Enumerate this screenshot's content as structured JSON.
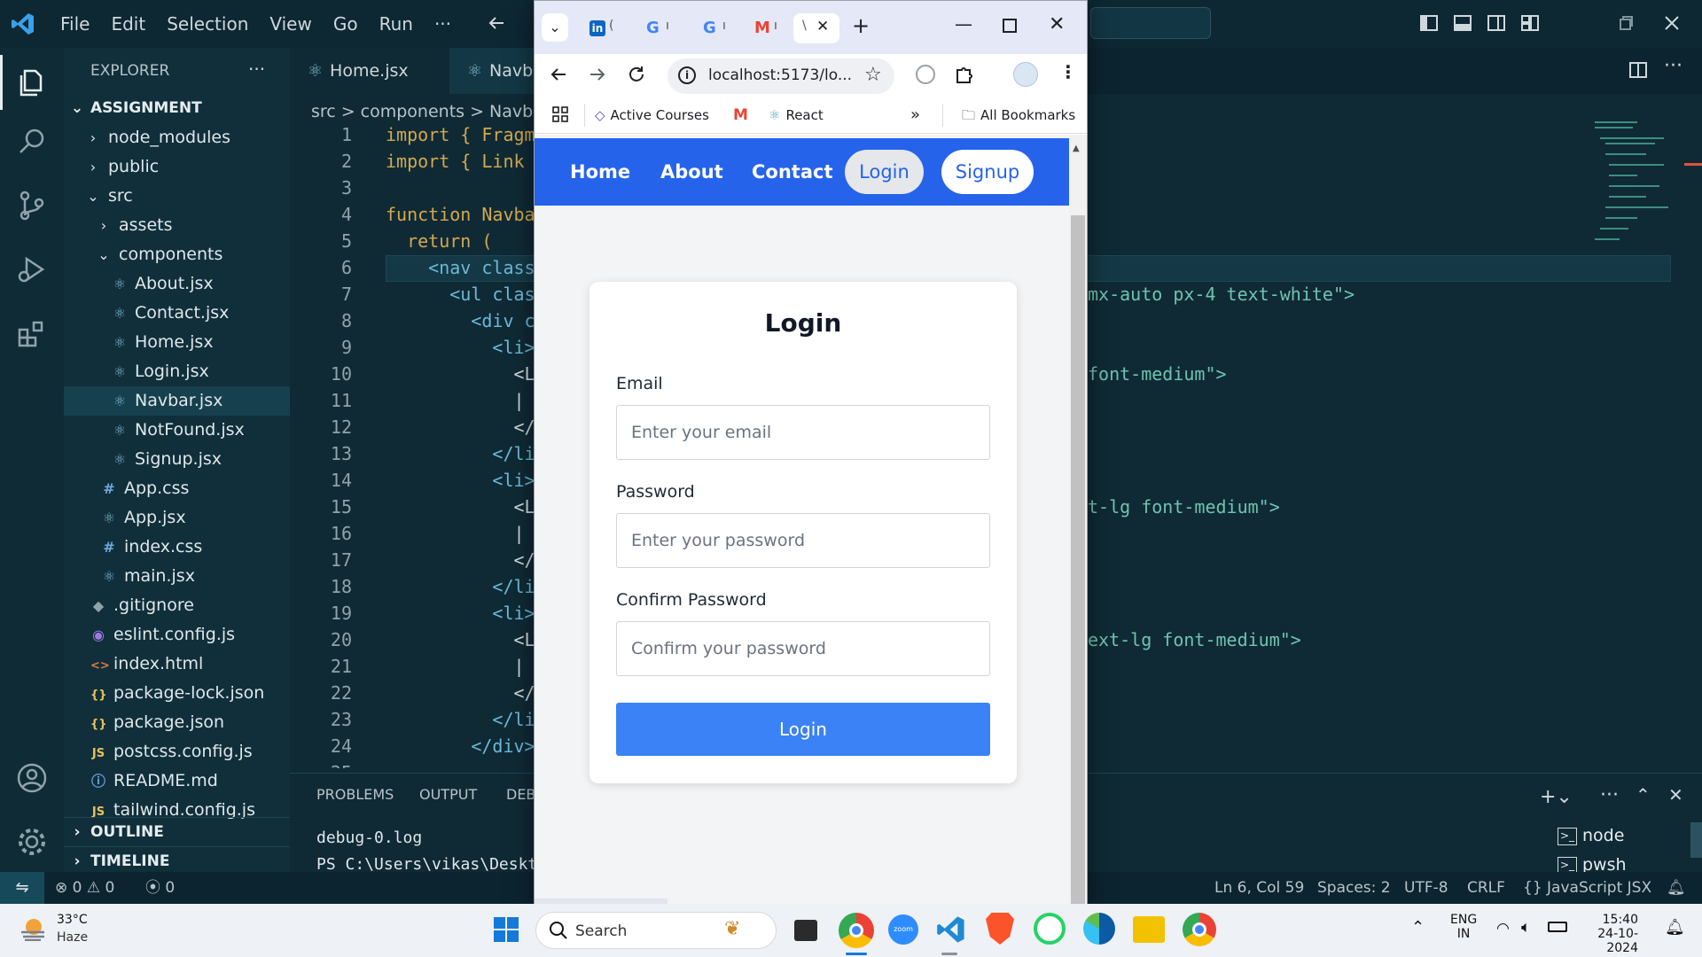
{
  "vscode": {
    "menus": [
      "File",
      "Edit",
      "Selection",
      "View",
      "Go",
      "Run",
      "···"
    ],
    "explorer": {
      "title": "EXPLORER",
      "more": "···",
      "root": "ASSIGNMENT",
      "items": [
        {
          "label": "node_modules",
          "icon": "›",
          "type": "folder"
        },
        {
          "label": "public",
          "icon": "›",
          "type": "folder"
        },
        {
          "label": "src",
          "icon": "⌄",
          "type": "folder"
        },
        {
          "label": "assets",
          "icon": "›",
          "type": "folder"
        },
        {
          "label": "components",
          "icon": "⌄",
          "type": "folder"
        },
        {
          "label": "About.jsx",
          "icon": "⚛",
          "type": "file"
        },
        {
          "label": "Contact.jsx",
          "icon": "⚛",
          "type": "file"
        },
        {
          "label": "Home.jsx",
          "icon": "⚛",
          "type": "file"
        },
        {
          "label": "Login.jsx",
          "icon": "⚛",
          "type": "file"
        },
        {
          "label": "Navbar.jsx",
          "icon": "⚛",
          "type": "file"
        },
        {
          "label": "NotFound.jsx",
          "icon": "⚛",
          "type": "file"
        },
        {
          "label": "Signup.jsx",
          "icon": "⚛",
          "type": "file"
        },
        {
          "label": "App.css",
          "icon": "#",
          "type": "file"
        },
        {
          "label": "App.jsx",
          "icon": "⚛",
          "type": "file"
        },
        {
          "label": "index.css",
          "icon": "#",
          "type": "file"
        },
        {
          "label": "main.jsx",
          "icon": "⚛",
          "type": "file"
        },
        {
          "label": ".gitignore",
          "icon": "◆",
          "type": "file"
        },
        {
          "label": "eslint.config.js",
          "icon": "◉",
          "type": "file"
        },
        {
          "label": "index.html",
          "icon": "<>",
          "type": "file"
        },
        {
          "label": "package-lock.json",
          "icon": "{}",
          "type": "file"
        },
        {
          "label": "package.json",
          "icon": "{}",
          "type": "file"
        },
        {
          "label": "postcss.config.js",
          "icon": "JS",
          "type": "file"
        },
        {
          "label": "README.md",
          "icon": "ⓘ",
          "type": "file"
        },
        {
          "label": "tailwind.config.js",
          "icon": "JS",
          "type": "file"
        }
      ],
      "outline": "OUTLINE",
      "timeline": "TIMELINE"
    },
    "tabs": [
      "Home.jsx",
      "Navb"
    ],
    "breadcrumb": [
      "src",
      ">",
      "components",
      ">",
      "Navb"
    ],
    "line_numbers": [
      "1",
      "2",
      "3",
      "4",
      "5",
      "6",
      "7",
      "8",
      "9",
      "10",
      "11",
      "12",
      "13",
      "14",
      "15",
      "16",
      "17",
      "18",
      "19",
      "20",
      "21",
      "22",
      "23",
      "24",
      "25"
    ],
    "code_left": [
      "import { Fragm",
      "import { Link",
      "",
      "function Navba",
      "  return (",
      "    <nav class",
      "      <ul clas",
      "        <div c",
      "          <li>",
      "            <L",
      "            |",
      "            </",
      "          </li",
      "          <li>",
      "            <L",
      "            |",
      "            </",
      "          </li",
      "          <li>",
      "            <L",
      "            |",
      "            </",
      "          </li",
      "        </div>",
      ""
    ],
    "code_right": [
      {
        "line": 7,
        "text": "mx-auto px-4 text-white\">"
      },
      {
        "line": 10,
        "text": "font-medium\">"
      },
      {
        "line": 15,
        "text": "t-lg font-medium\">"
      },
      {
        "line": 20,
        "text": "ext-lg font-medium\">"
      }
    ],
    "panel": {
      "tabs": [
        "PROBLEMS",
        "OUTPUT",
        "DEB"
      ],
      "lines": [
        "debug-0.log",
        "PS C:\\Users\\vikas\\Deskt"
      ],
      "terminals": [
        "node",
        "pwsh"
      ]
    },
    "status": {
      "errors": "0",
      "warnings": "0",
      "ports": "0",
      "position": "Ln 6, Col 59",
      "spaces": "Spaces: 2",
      "encoding": "UTF-8",
      "eol": "CRLF",
      "language": "JavaScript JSX"
    }
  },
  "browser": {
    "url": "localhost:5173/lo...",
    "bookmarks": [
      "Active Courses",
      "React"
    ],
    "all_bookmarks": "All Bookmarks",
    "overflow": "»",
    "tab_initials": [
      "(",
      "ı",
      "ı",
      "ı",
      "\\"
    ],
    "page": {
      "nav": [
        "Home",
        "About",
        "Contact"
      ],
      "login_btn": "Login",
      "signup_btn": "Signup",
      "title": "Login",
      "email_label": "Email",
      "email_placeholder": "Enter your email",
      "password_label": "Password",
      "password_placeholder": "Enter your password",
      "confirm_label": "Confirm Password",
      "confirm_placeholder": "Confirm your password",
      "submit": "Login"
    },
    "colors": {
      "nav": "#2563eb",
      "submit": "#3b82f6"
    }
  },
  "taskbar": {
    "temp": "33°C",
    "weather": "Haze",
    "search": "Search",
    "lang1": "ENG",
    "lang2": "IN",
    "time": "15:40",
    "date": "24-10-2024"
  }
}
